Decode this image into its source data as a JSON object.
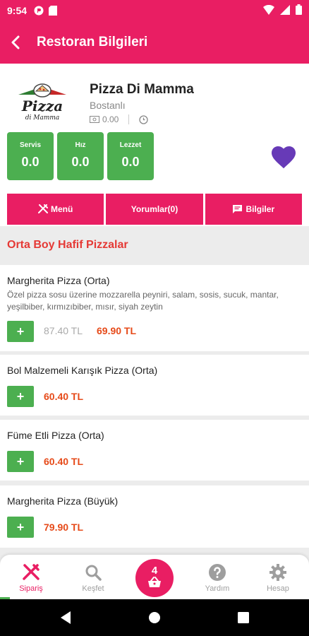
{
  "status_bar": {
    "time": "9:54"
  },
  "app_bar": {
    "title": "Restoran Bilgileri"
  },
  "restaurant": {
    "name": "Pizza Di Mamma",
    "location": "Bostanlı",
    "min_order": "0.00",
    "logo_text": "Pizza",
    "logo_subtext": "di Mamma"
  },
  "scores": [
    {
      "label": "Servis",
      "value": "0.0"
    },
    {
      "label": "Hız",
      "value": "0.0"
    },
    {
      "label": "Lezzet",
      "value": "0.0"
    }
  ],
  "tabs": [
    "Menü",
    "Yorumlar(0)",
    "Bilgiler"
  ],
  "section_title": "Orta Boy Hafif Pizzalar",
  "items": [
    {
      "name": "Margherita Pizza (Orta)",
      "description": "Özel pizza sosu üzerine mozzarella peyniri, salam, sosis, sucuk, mantar, yeşilbiber, kırmızıbiber, mısır, siyah zeytin",
      "old_price": "87.40 TL",
      "price": "69.90 TL"
    },
    {
      "name": "Bol Malzemeli Karışık Pizza (Orta)",
      "price": "60.40 TL"
    },
    {
      "name": "Füme Etli Pizza (Orta)",
      "price": "60.40 TL"
    },
    {
      "name": "Margherita Pizza (Büyük)",
      "price": "79.90 TL"
    }
  ],
  "add_label": "+",
  "bottom_nav": {
    "items": [
      "Sipariş",
      "Keşfet",
      "Yardım",
      "Hesap"
    ],
    "cart_count": "4"
  },
  "colors": {
    "primary": "#e91e63",
    "green": "#4caf50",
    "price": "#e64a19",
    "heart": "#673ab7"
  }
}
